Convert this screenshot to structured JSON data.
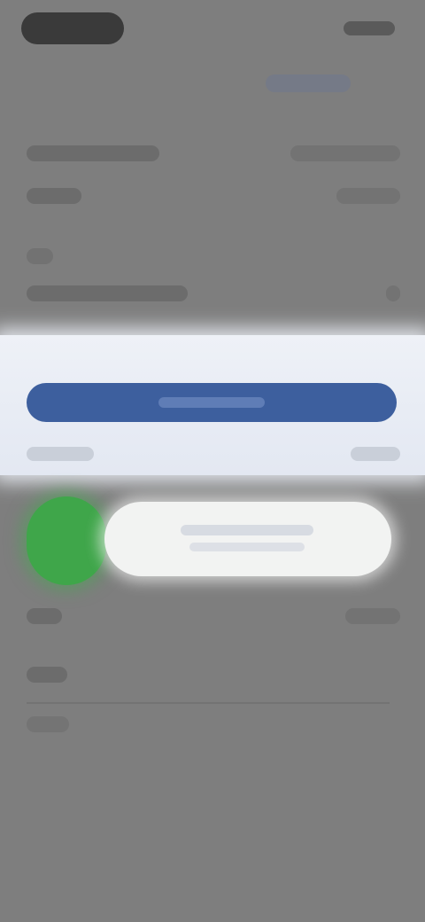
{
  "status_bar": {
    "time": "",
    "indicators": ""
  },
  "header": {
    "action_label": ""
  },
  "rows": [
    {
      "name": "row-1",
      "label": "",
      "value": ""
    },
    {
      "name": "row-2",
      "label": "",
      "value": ""
    },
    {
      "name": "row-3",
      "label": "",
      "value": ""
    },
    {
      "name": "row-4",
      "label": "",
      "value": ""
    }
  ],
  "highlight": {
    "button_label": "",
    "footer_left": "",
    "footer_right": ""
  },
  "pill": {
    "text": ""
  },
  "lower": {
    "label": "",
    "value": "",
    "section_label": "",
    "caption": ""
  },
  "colors": {
    "background": "#7e7e7e",
    "primary": "#3d5f9e",
    "accent_green": "#3fa64a",
    "highlight_bg": "#eef1f7"
  }
}
